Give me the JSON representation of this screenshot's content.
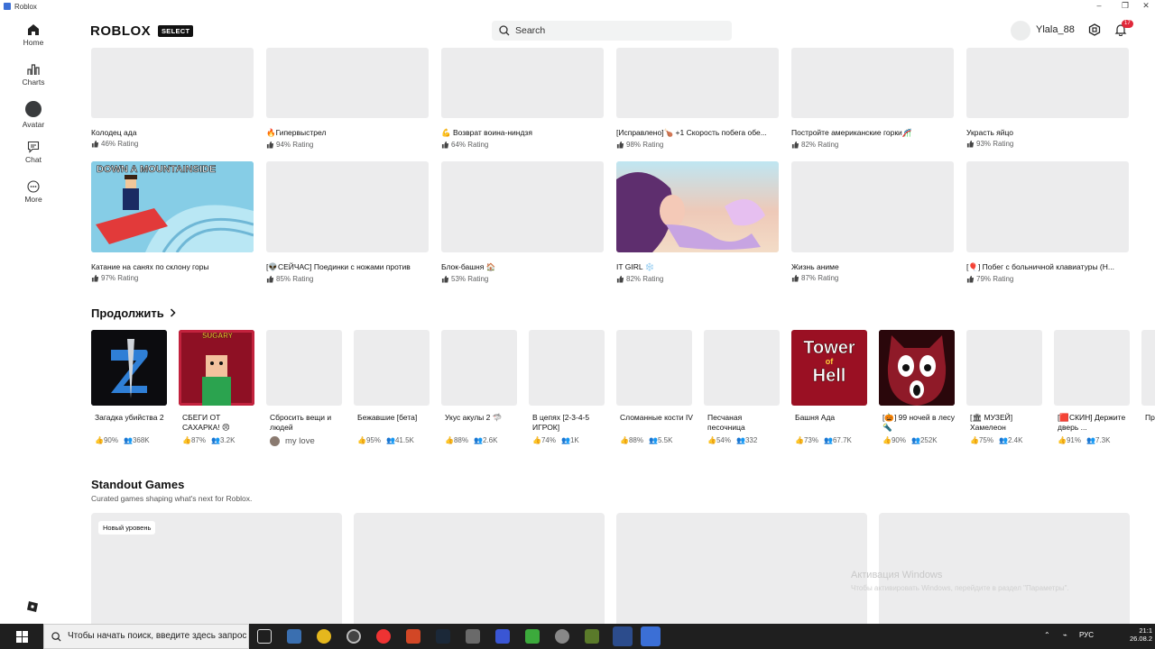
{
  "window": {
    "title": "Roblox"
  },
  "sidebar": {
    "items": [
      {
        "label": "Home"
      },
      {
        "label": "Charts"
      },
      {
        "label": "Avatar"
      },
      {
        "label": "Chat"
      },
      {
        "label": "More"
      }
    ]
  },
  "header": {
    "logo": "ROBLOX",
    "badge": "SELECT",
    "search_placeholder": "Search",
    "username": "Ylala_88",
    "notifications": "17"
  },
  "grid_row1": [
    {
      "name": "Колодец ада",
      "rating": "46% Rating"
    },
    {
      "name": "🔥Гипервыстрел",
      "rating": "94% Rating"
    },
    {
      "name": "💪 Возврат воина-ниндзя",
      "rating": "64% Rating"
    },
    {
      "name": "[Исправлено]🍗 +1 Скорость побега обе...",
      "rating": "98% Rating"
    },
    {
      "name": "Постройте американские горки🎢",
      "rating": "82% Rating"
    },
    {
      "name": "Украсть яйцо",
      "rating": "93% Rating"
    }
  ],
  "grid_row2": [
    {
      "name": "Катание на санях по склону горы",
      "rating": "97% Rating",
      "thumb_text": "DOWN A MOUNTAINSIDE"
    },
    {
      "name": "[👽СЕЙЧАС] Поединки с ножами против",
      "rating": "85% Rating"
    },
    {
      "name": "Блок-башня 🏠",
      "rating": "53% Rating"
    },
    {
      "name": "IT GIRL ❄️",
      "rating": "82% Rating"
    },
    {
      "name": "Жизнь аниме",
      "rating": "87% Rating"
    },
    {
      "name": "[🎈] Побег с больничной клавиатуры (Н...",
      "rating": "79% Rating"
    }
  ],
  "continue": {
    "title": "Продолжить",
    "items": [
      {
        "name": "Загадка убийства 2",
        "rating": "90%",
        "players": "368K"
      },
      {
        "name": "СБЕГИ ОТ САХАРКА! 😠",
        "rating": "87%",
        "players": "3.2K",
        "thumb_text": "SUGARY"
      },
      {
        "name": "Сбросить вещи и людей",
        "friend": "my love"
      },
      {
        "name": "Бежавшие [бета]",
        "rating": "95%",
        "players": "41.5K"
      },
      {
        "name": "Укус акулы 2 🦈",
        "rating": "88%",
        "players": "2.6K"
      },
      {
        "name": "В цепях [2-3-4-5 ИГРОК]",
        "rating": "74%",
        "players": "1K"
      },
      {
        "name": "Сломанные кости IV",
        "rating": "88%",
        "players": "5.5K"
      },
      {
        "name": "Песчаная песочница",
        "rating": "54%",
        "players": "332"
      },
      {
        "name": "Башня Ада",
        "rating": "73%",
        "players": "67.7K",
        "thumb_text": [
          "Tower",
          "of",
          "Hell"
        ]
      },
      {
        "name": "[🎃] 99 ночей в лесу 🔦",
        "rating": "90%",
        "players": "252K"
      },
      {
        "name": "[🏛 МУЗЕЙ] Хамелеон",
        "rating": "75%",
        "players": "2.4K"
      },
      {
        "name": "[🟥СКИН] Держите дверь ...",
        "rating": "91%",
        "players": "7.3K"
      },
      {
        "name": "Пр по"
      }
    ]
  },
  "standout": {
    "title": "Standout Games",
    "subtitle": "Curated games shaping what's next for Roblox.",
    "tag": "Новый уровень"
  },
  "watermark": {
    "line1": "Активация Windows",
    "line2": "Чтобы активировать Windows, перейдите в раздел \"Параметры\"."
  },
  "taskbar": {
    "search_placeholder": "Чтобы начать поиск, введите здесь запрос",
    "lang": "РУС",
    "time": "21:1",
    "date": "26.08.2"
  },
  "colors": {
    "accent": "#3b6fd6",
    "badge": "#e0283a",
    "placeholder": "#ececed"
  }
}
